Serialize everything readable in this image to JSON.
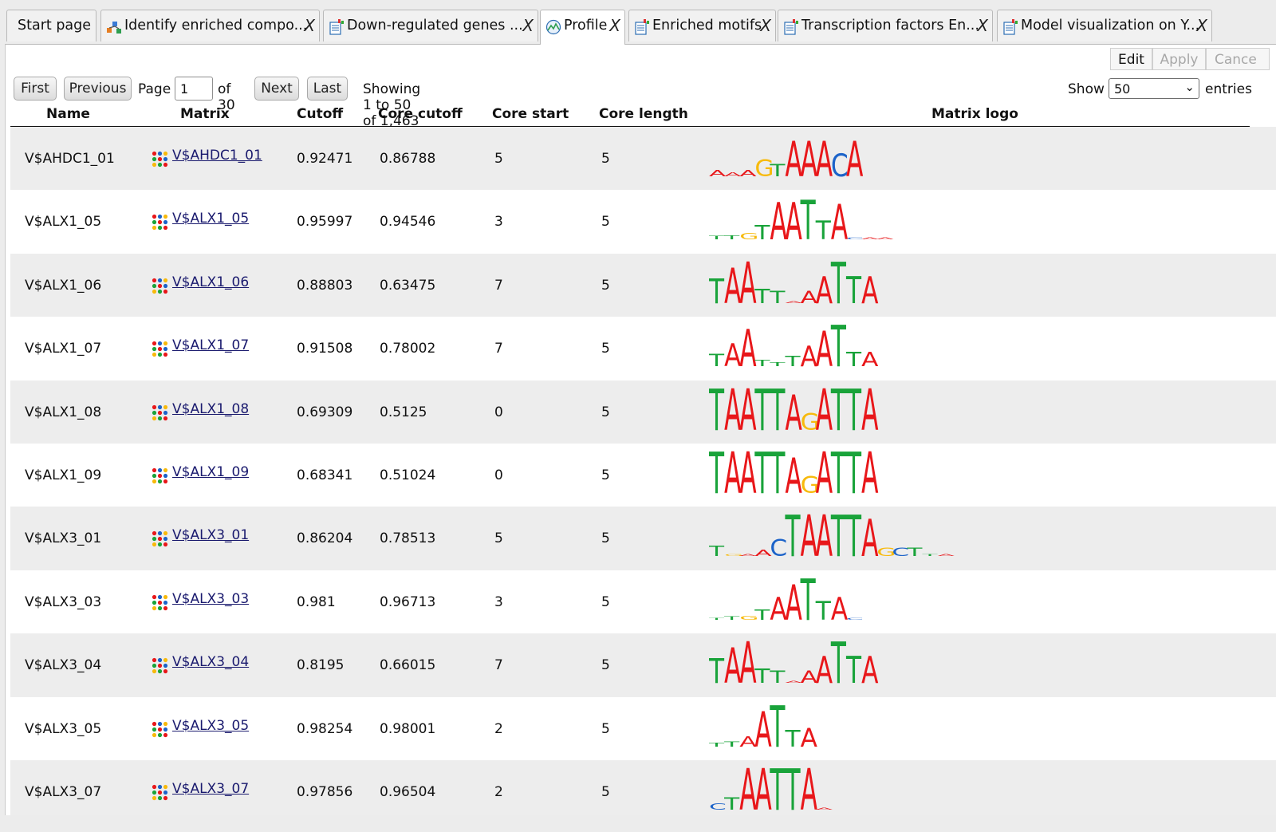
{
  "tabs": [
    {
      "label": "Start page",
      "icon": "none",
      "closable": false,
      "active": false
    },
    {
      "label": "Identify enriched compo...",
      "icon": "workflow-icon",
      "closable": true,
      "active": false
    },
    {
      "label": "Down-regulated genes ...",
      "icon": "table-doc-icon",
      "closable": true,
      "active": false
    },
    {
      "label": "Profile",
      "icon": "profile-icon",
      "closable": true,
      "active": true
    },
    {
      "label": "Enriched motifs",
      "icon": "table-doc-icon",
      "closable": true,
      "active": false
    },
    {
      "label": "Transcription factors En...",
      "icon": "table-doc-icon",
      "closable": true,
      "active": false
    },
    {
      "label": "Model visualization on Y...",
      "icon": "table-doc-icon",
      "closable": true,
      "active": false
    }
  ],
  "close_glyph": "X",
  "edit_toolbar": {
    "edit": "Edit",
    "apply": "Apply",
    "cancel": "Cance"
  },
  "pager": {
    "first": "First",
    "previous": "Previous",
    "page_label": "Page",
    "page_value": "1",
    "of_label": "of 30",
    "next": "Next",
    "last": "Last",
    "showing": "Showing 1 to 50 of 1,463 entries"
  },
  "show": {
    "label": "Show",
    "value": "50",
    "suffix": "entries"
  },
  "columns": [
    "Name",
    "Matrix",
    "Cutoff",
    "Core cutoff",
    "Core start",
    "Core length",
    "Matrix logo"
  ],
  "rows": [
    {
      "name": "V$AHDC1_01",
      "matrix": "V$AHDC1_01",
      "cutoff": "0.92471",
      "core_cutoff": "0.86788",
      "core_start": "5",
      "core_length": "5"
    },
    {
      "name": "V$ALX1_05",
      "matrix": "V$ALX1_05",
      "cutoff": "0.95997",
      "core_cutoff": "0.94546",
      "core_start": "3",
      "core_length": "5"
    },
    {
      "name": "V$ALX1_06",
      "matrix": "V$ALX1_06",
      "cutoff": "0.88803",
      "core_cutoff": "0.63475",
      "core_start": "7",
      "core_length": "5"
    },
    {
      "name": "V$ALX1_07",
      "matrix": "V$ALX1_07",
      "cutoff": "0.91508",
      "core_cutoff": "0.78002",
      "core_start": "7",
      "core_length": "5"
    },
    {
      "name": "V$ALX1_08",
      "matrix": "V$ALX1_08",
      "cutoff": "0.69309",
      "core_cutoff": "0.5125",
      "core_start": "0",
      "core_length": "5"
    },
    {
      "name": "V$ALX1_09",
      "matrix": "V$ALX1_09",
      "cutoff": "0.68341",
      "core_cutoff": "0.51024",
      "core_start": "0",
      "core_length": "5"
    },
    {
      "name": "V$ALX3_01",
      "matrix": "V$ALX3_01",
      "cutoff": "0.86204",
      "core_cutoff": "0.78513",
      "core_start": "5",
      "core_length": "5"
    },
    {
      "name": "V$ALX3_03",
      "matrix": "V$ALX3_03",
      "cutoff": "0.981",
      "core_cutoff": "0.96713",
      "core_start": "3",
      "core_length": "5"
    },
    {
      "name": "V$ALX3_04",
      "matrix": "V$ALX3_04",
      "cutoff": "0.8195",
      "core_cutoff": "0.66015",
      "core_start": "7",
      "core_length": "5"
    },
    {
      "name": "V$ALX3_05",
      "matrix": "V$ALX3_05",
      "cutoff": "0.98254",
      "core_cutoff": "0.98001",
      "core_start": "2",
      "core_length": "5"
    },
    {
      "name": "V$ALX3_07",
      "matrix": "V$ALX3_07",
      "cutoff": "0.97856",
      "core_cutoff": "0.96504",
      "core_start": "2",
      "core_length": "5"
    }
  ],
  "logos": [
    [
      [
        "A",
        0.15
      ],
      [
        "A",
        0.1
      ],
      [
        "A",
        0.15
      ],
      [
        "G",
        0.4
      ],
      [
        "T",
        0.3
      ],
      [
        "A",
        0.85
      ],
      [
        "A",
        0.85
      ],
      [
        "A",
        0.85
      ],
      [
        "C",
        0.55
      ],
      [
        "A",
        0.85
      ]
    ],
    [
      [
        "T",
        0.08
      ],
      [
        "T",
        0.1
      ],
      [
        "G",
        0.15
      ],
      [
        "T",
        0.35
      ],
      [
        "A",
        0.9
      ],
      [
        "A",
        0.9
      ],
      [
        "T",
        0.95
      ],
      [
        "T",
        0.45
      ],
      [
        "A",
        0.85
      ],
      [
        "C",
        0.05
      ],
      [
        "A",
        0.05
      ],
      [
        "A",
        0.05
      ]
    ],
    [
      [
        "T",
        0.6
      ],
      [
        "A",
        0.85
      ],
      [
        "A",
        1.0
      ],
      [
        "T",
        0.35
      ],
      [
        "T",
        0.3
      ],
      [
        "A",
        0.05
      ],
      [
        "A",
        0.3
      ],
      [
        "A",
        0.65
      ],
      [
        "T",
        1.0
      ],
      [
        "T",
        0.65
      ],
      [
        "A",
        0.65
      ]
    ],
    [
      [
        "T",
        0.3
      ],
      [
        "A",
        0.55
      ],
      [
        "A",
        0.9
      ],
      [
        "T",
        0.15
      ],
      [
        "T",
        0.1
      ],
      [
        "T",
        0.25
      ],
      [
        "A",
        0.5
      ],
      [
        "A",
        0.85
      ],
      [
        "T",
        1.0
      ],
      [
        "T",
        0.35
      ],
      [
        "A",
        0.35
      ]
    ],
    [
      [
        "T",
        1.0
      ],
      [
        "A",
        1.0
      ],
      [
        "A",
        1.0
      ],
      [
        "T",
        1.0
      ],
      [
        "T",
        1.0
      ],
      [
        "A",
        0.85
      ],
      [
        "G",
        0.4
      ],
      [
        "A",
        1.0
      ],
      [
        "T",
        1.0
      ],
      [
        "T",
        1.0
      ],
      [
        "A",
        1.0
      ]
    ],
    [
      [
        "T",
        1.0
      ],
      [
        "A",
        1.0
      ],
      [
        "A",
        1.0
      ],
      [
        "T",
        1.0
      ],
      [
        "T",
        1.0
      ],
      [
        "A",
        0.85
      ],
      [
        "G",
        0.4
      ],
      [
        "A",
        1.0
      ],
      [
        "T",
        1.0
      ],
      [
        "T",
        1.0
      ],
      [
        "A",
        1.0
      ]
    ],
    [
      [
        "T",
        0.25
      ],
      [
        "G",
        0.05
      ],
      [
        "A",
        0.05
      ],
      [
        "A",
        0.15
      ],
      [
        "C",
        0.4
      ],
      [
        "T",
        1.0
      ],
      [
        "A",
        1.0
      ],
      [
        "A",
        1.0
      ],
      [
        "T",
        1.0
      ],
      [
        "T",
        1.0
      ],
      [
        "A",
        0.9
      ],
      [
        "G",
        0.2
      ],
      [
        "C",
        0.2
      ],
      [
        "T",
        0.2
      ],
      [
        "T",
        0.05
      ],
      [
        "A",
        0.05
      ]
    ],
    [
      [
        "T",
        0.05
      ],
      [
        "T",
        0.08
      ],
      [
        "G",
        0.1
      ],
      [
        "T",
        0.25
      ],
      [
        "A",
        0.55
      ],
      [
        "A",
        0.85
      ],
      [
        "T",
        1.0
      ],
      [
        "T",
        0.45
      ],
      [
        "A",
        0.55
      ],
      [
        "C",
        0.05
      ]
    ],
    [
      [
        "T",
        0.6
      ],
      [
        "A",
        0.85
      ],
      [
        "A",
        1.0
      ],
      [
        "T",
        0.35
      ],
      [
        "T",
        0.3
      ],
      [
        "A",
        0.05
      ],
      [
        "A",
        0.3
      ],
      [
        "A",
        0.65
      ],
      [
        "T",
        1.0
      ],
      [
        "T",
        0.65
      ],
      [
        "A",
        0.65
      ]
    ],
    [
      [
        "T",
        0.1
      ],
      [
        "T",
        0.12
      ],
      [
        "A",
        0.25
      ],
      [
        "A",
        0.85
      ],
      [
        "T",
        1.0
      ],
      [
        "T",
        0.4
      ],
      [
        "A",
        0.45
      ]
    ],
    [
      [
        "C",
        0.15
      ],
      [
        "T",
        0.3
      ],
      [
        "A",
        1.0
      ],
      [
        "A",
        1.0
      ],
      [
        "T",
        1.0
      ],
      [
        "T",
        1.0
      ],
      [
        "A",
        1.0
      ],
      [
        "A",
        0.05
      ]
    ]
  ],
  "nucleotide_colors": {
    "A": "#e8171a",
    "C": "#1c63c9",
    "G": "#f7ba0c",
    "T": "#19a33a"
  }
}
